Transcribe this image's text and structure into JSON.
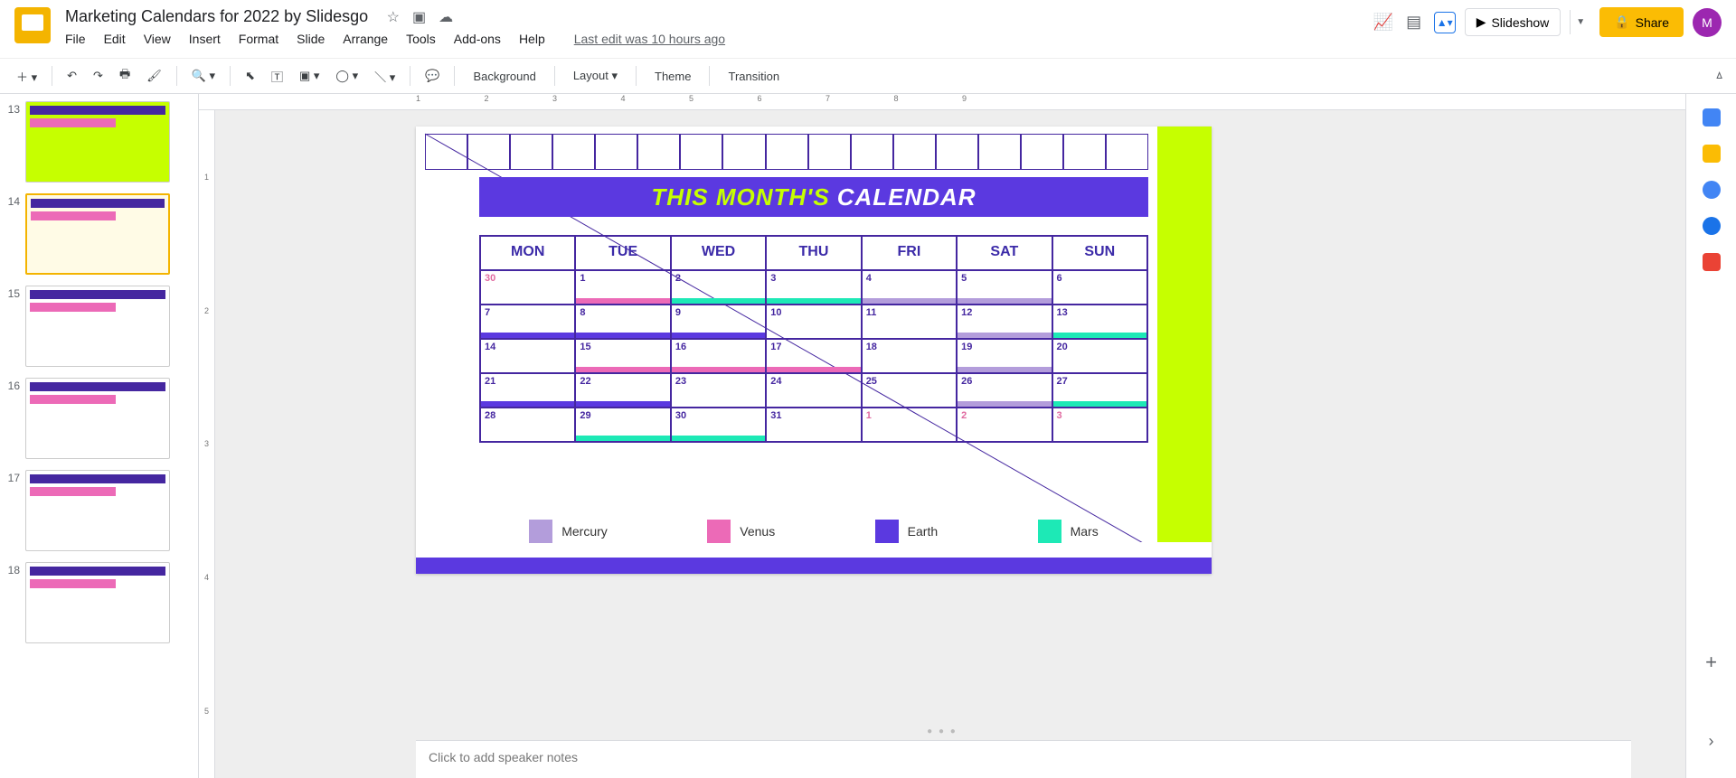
{
  "doc": {
    "title": "Marketing Calendars for 2022 by Slidesgo",
    "lastEdit": "Last edit was 10 hours ago"
  },
  "menus": [
    "File",
    "Edit",
    "View",
    "Insert",
    "Format",
    "Slide",
    "Arrange",
    "Tools",
    "Add-ons",
    "Help"
  ],
  "toolbar": {
    "background": "Background",
    "layout": "Layout",
    "theme": "Theme",
    "transition": "Transition"
  },
  "header": {
    "slideshow": "Slideshow",
    "share": "Share",
    "avatar": "M"
  },
  "thumbs": [
    {
      "num": "13",
      "cls": "lime"
    },
    {
      "num": "14",
      "cls": "selected"
    },
    {
      "num": "15",
      "cls": ""
    },
    {
      "num": "16",
      "cls": ""
    },
    {
      "num": "17",
      "cls": ""
    },
    {
      "num": "18",
      "cls": ""
    }
  ],
  "slide": {
    "title1": "THIS MONTH'S",
    "title2": "CALENDAR",
    "days": [
      "MON",
      "TUE",
      "WED",
      "THU",
      "FRI",
      "SAT",
      "SUN"
    ],
    "weeks": [
      [
        {
          "n": "30",
          "f": 1,
          "c": ""
        },
        {
          "n": "1",
          "c": "#ec6ab7"
        },
        {
          "n": "2",
          "c": "#1de9b6"
        },
        {
          "n": "3",
          "c": "#1de9b6"
        },
        {
          "n": "4",
          "c": "#b39ddb"
        },
        {
          "n": "5",
          "c": "#b39ddb"
        },
        {
          "n": "6",
          "c": ""
        }
      ],
      [
        {
          "n": "7",
          "c": "#5b39e0"
        },
        {
          "n": "8",
          "c": "#5b39e0"
        },
        {
          "n": "9",
          "c": "#5b39e0"
        },
        {
          "n": "10",
          "c": ""
        },
        {
          "n": "11",
          "c": ""
        },
        {
          "n": "12",
          "c": "#b39ddb"
        },
        {
          "n": "13",
          "c": "#1de9b6"
        }
      ],
      [
        {
          "n": "14",
          "c": ""
        },
        {
          "n": "15",
          "c": "#ec6ab7"
        },
        {
          "n": "16",
          "c": "#ec6ab7"
        },
        {
          "n": "17",
          "c": "#ec6ab7"
        },
        {
          "n": "18",
          "c": ""
        },
        {
          "n": "19",
          "c": "#b39ddb"
        },
        {
          "n": "20",
          "c": ""
        }
      ],
      [
        {
          "n": "21",
          "c": "#5b39e0"
        },
        {
          "n": "22",
          "c": "#5b39e0"
        },
        {
          "n": "23",
          "c": ""
        },
        {
          "n": "24",
          "c": ""
        },
        {
          "n": "25",
          "c": ""
        },
        {
          "n": "26",
          "c": "#b39ddb"
        },
        {
          "n": "27",
          "c": "#1de9b6"
        }
      ],
      [
        {
          "n": "28",
          "c": ""
        },
        {
          "n": "29",
          "c": "#1de9b6"
        },
        {
          "n": "30",
          "c": "#1de9b6"
        },
        {
          "n": "31",
          "c": ""
        },
        {
          "n": "1",
          "f": 1,
          "c": ""
        },
        {
          "n": "2",
          "f": 1,
          "c": ""
        },
        {
          "n": "3",
          "f": 1,
          "c": ""
        }
      ]
    ],
    "legend": [
      {
        "name": "Mercury",
        "c": "#b39ddb",
        "s": "#ec6ab7"
      },
      {
        "name": "Venus",
        "c": "#ec6ab7",
        "s": "#5b39e0"
      },
      {
        "name": "Earth",
        "c": "#5b39e0",
        "s": "#ec6ab7"
      },
      {
        "name": "Mars",
        "c": "#1de9b6",
        "s": "#5b39e0"
      }
    ]
  },
  "notes": {
    "placeholder": "Click to add speaker notes"
  },
  "ruler": "            1           2           3           4           5           6           7           8           9"
}
